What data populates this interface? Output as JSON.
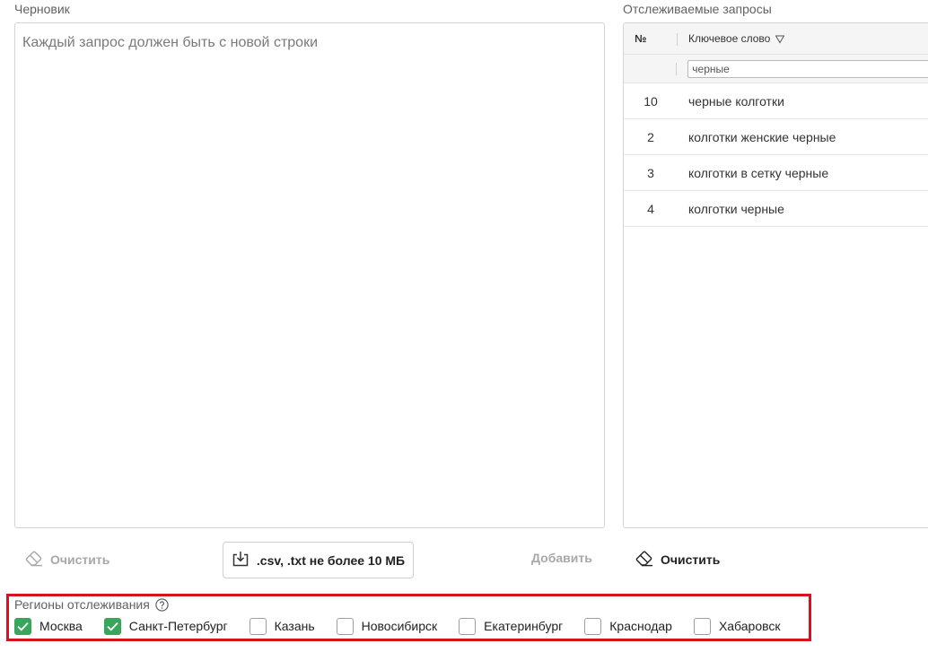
{
  "draft": {
    "label": "Черновик",
    "placeholder": "Каждый запрос должен быть с новой строки"
  },
  "tracked": {
    "label": "Отслеживаемые запросы",
    "columns": {
      "num": "№",
      "keyword": "Ключевое слово"
    },
    "filter_value": "черные",
    "rows": [
      {
        "num": "10",
        "keyword": "черные колготки"
      },
      {
        "num": "2",
        "keyword": "колготки женские черные"
      },
      {
        "num": "3",
        "keyword": "колготки в сетку черные"
      },
      {
        "num": "4",
        "keyword": "колготки черные"
      }
    ]
  },
  "actions": {
    "clear_left": "Очистить",
    "upload": ".csv, .txt не более 10 МБ",
    "add": "Добавить",
    "clear_right": "Очистить"
  },
  "regions": {
    "title": "Регионы отслеживания",
    "items": [
      {
        "label": "Москва",
        "checked": true
      },
      {
        "label": "Санкт-Петербург",
        "checked": true
      },
      {
        "label": "Казань",
        "checked": false
      },
      {
        "label": "Новосибирск",
        "checked": false
      },
      {
        "label": "Екатеринбург",
        "checked": false
      },
      {
        "label": "Краснодар",
        "checked": false
      },
      {
        "label": "Хабаровск",
        "checked": false
      }
    ]
  },
  "colors": {
    "checkbox_checked": "#3aa55c",
    "highlight_frame": "#d3141d"
  },
  "icons": {
    "clear": "eraser-icon",
    "upload": "download-tray-icon",
    "filter": "filter-icon",
    "help": "question-circle-icon",
    "check": "check-icon"
  }
}
